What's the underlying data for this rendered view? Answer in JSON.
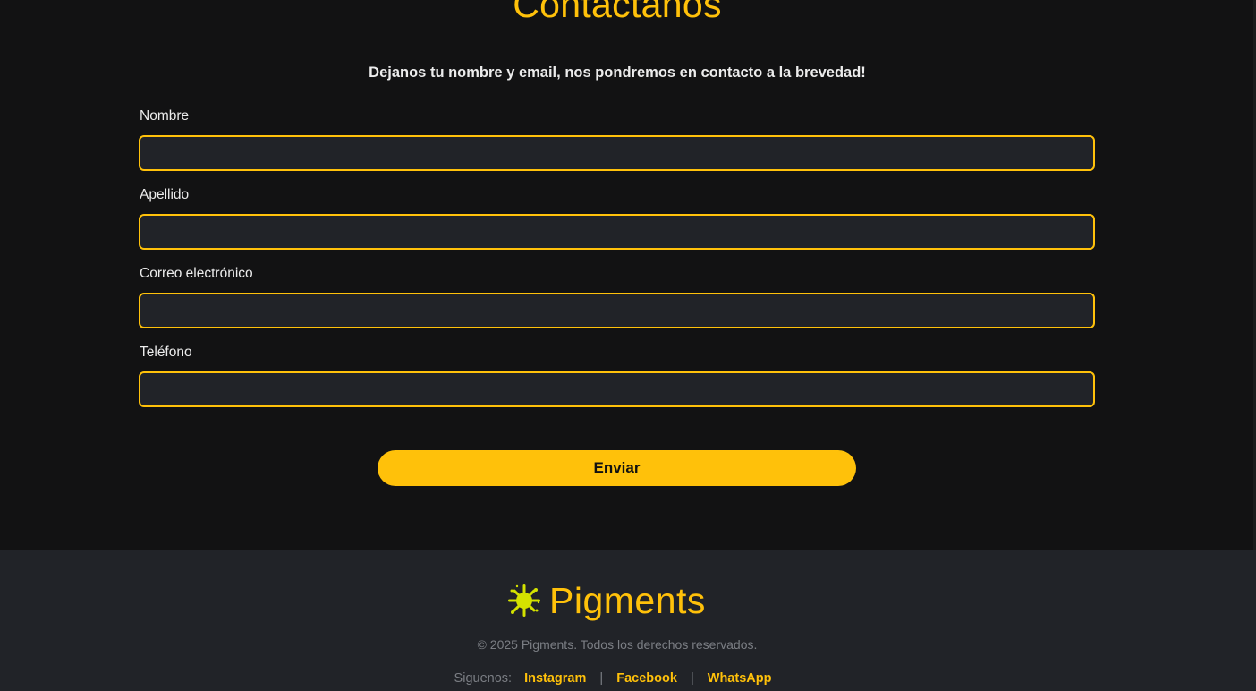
{
  "contact": {
    "title": "Contáctanos",
    "subtitle": "Dejanos tu nombre y email, nos pondremos en contacto a la brevedad!",
    "fields": [
      {
        "label": "Nombre",
        "value": "",
        "placeholder": ""
      },
      {
        "label": "Apellido",
        "value": "",
        "placeholder": ""
      },
      {
        "label": "Correo electrónico",
        "value": "",
        "placeholder": ""
      },
      {
        "label": "Teléfono",
        "value": "",
        "placeholder": ""
      }
    ],
    "submit_label": "Enviar"
  },
  "footer": {
    "brand_name": "Pigments",
    "logo_icon": "paint-splash-icon",
    "copyright": "© 2025 Pigments. Todos los derechos reservados.",
    "follow_label": "Siguenos:",
    "social_links": [
      {
        "label": "Instagram"
      },
      {
        "label": "Facebook"
      },
      {
        "label": "WhatsApp"
      }
    ],
    "separator": "|"
  },
  "colors": {
    "accent": "#ffc10a",
    "background": "#121213",
    "footer_background": "#212328",
    "input_background": "#212328",
    "muted_text": "#7b7e84",
    "logo_color": "#d4e200"
  }
}
